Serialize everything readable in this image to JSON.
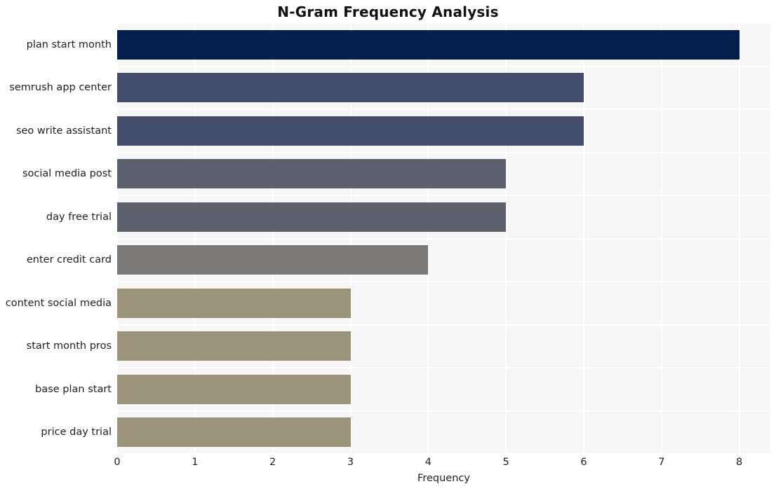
{
  "chart_data": {
    "type": "bar",
    "orientation": "horizontal",
    "title": "N-Gram Frequency Analysis",
    "xlabel": "Frequency",
    "ylabel": "",
    "categories": [
      "plan start month",
      "semrush app center",
      "seo write assistant",
      "social media post",
      "day free trial",
      "enter credit card",
      "content social media",
      "start month pros",
      "base plan start",
      "price day trial"
    ],
    "values": [
      8,
      6,
      6,
      5,
      5,
      4,
      3,
      3,
      3,
      3
    ],
    "bar_colors": [
      "#03204c",
      "#444d6b",
      "#444d6b",
      "#5d616e",
      "#5d616e",
      "#7a7877",
      "#9a9379",
      "#9a9379",
      "#9a9379",
      "#9a9379"
    ],
    "xlim": [
      0,
      8.4
    ],
    "xticks": [
      0,
      1,
      2,
      3,
      4,
      5,
      6,
      7,
      8
    ],
    "xtick_labels": [
      "0",
      "1",
      "2",
      "3",
      "4",
      "5",
      "6",
      "7",
      "8"
    ],
    "grid": true,
    "grid_color": "#ffffff",
    "plot_background": "#f6f6f7",
    "figure_background": "#ffffff",
    "legend": null
  }
}
